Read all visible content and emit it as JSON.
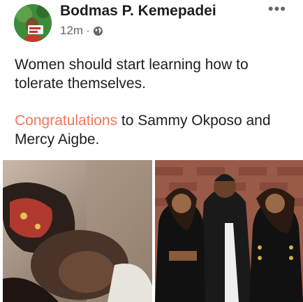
{
  "post": {
    "author": "Bodmas P. Kemepadei",
    "time": "12m",
    "separator": "·",
    "privacy_icon": "globe-icon",
    "more_icon": "more-options-icon",
    "more_label": "•••",
    "line1": "Women should start learning how to tolerate themselves.",
    "highlight": "Congratulations",
    "line2_rest": " to Sammy Okposo and Mercy Aigbe.",
    "colors": {
      "author": "#1c1e21",
      "meta": "#65676b",
      "highlight": "#f0775a"
    }
  }
}
